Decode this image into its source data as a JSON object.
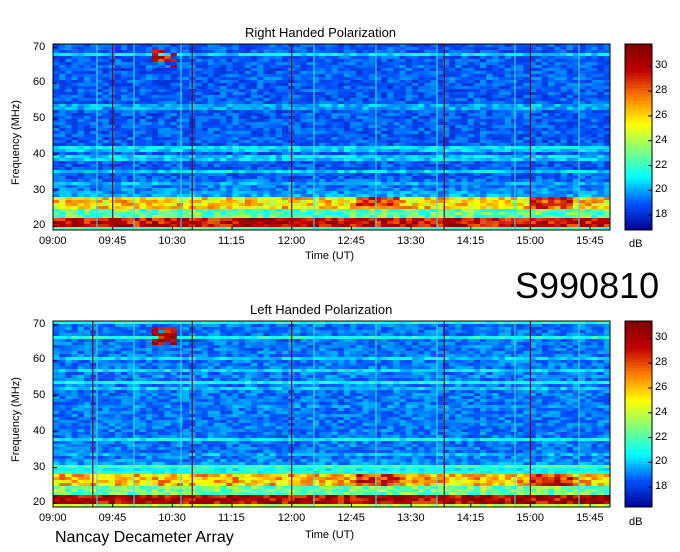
{
  "figure": {
    "dataset_id": "S990810",
    "instrument": "Nancay Decameter Array"
  },
  "panels": [
    {
      "title": "Right Handed Polarization",
      "xlabel": "Time (UT)",
      "ylabel": "Frequency (MHz)",
      "colorbar_unit": "dB"
    },
    {
      "title": "Left Handed Polarization",
      "xlabel": "Time (UT)",
      "ylabel": "Frequency (MHz)",
      "colorbar_unit": "dB"
    }
  ],
  "chart_data": [
    {
      "type": "heatmap",
      "title": "Right Handed Polarization",
      "xlabel": "Time (UT)",
      "ylabel": "Frequency (MHz)",
      "x_ticks": [
        "09:00",
        "09:45",
        "10:30",
        "11:15",
        "12:00",
        "12:45",
        "13:30",
        "14:15",
        "15:00",
        "15:45"
      ],
      "x_range_minutes_ut": [
        540,
        960
      ],
      "y_ticks": [
        20,
        30,
        40,
        50,
        60,
        70
      ],
      "ylim": [
        19,
        71
      ],
      "colorbar": {
        "unit": "dB",
        "ticks": [
          18,
          20,
          22,
          24,
          26,
          28,
          30
        ],
        "range": [
          16.8,
          31.8
        ]
      },
      "vertical_markers_ut": [
        "09:45",
        "10:45",
        "12:00",
        "13:55",
        "15:00"
      ],
      "colormap": [
        "#00008f",
        "#0050ff",
        "#00ffff",
        "#7fff7f",
        "#ffff00",
        "#ff8000",
        "#c00000",
        "#800000"
      ],
      "features": {
        "strong_band_MHz": [
          20,
          22
        ],
        "secondary_band_MHz": [
          25,
          28
        ],
        "background_dB": 19
      }
    },
    {
      "type": "heatmap",
      "title": "Left Handed Polarization",
      "xlabel": "Time (UT)",
      "ylabel": "Frequency (MHz)",
      "x_ticks": [
        "09:00",
        "09:45",
        "10:30",
        "11:15",
        "12:00",
        "12:45",
        "13:30",
        "14:15",
        "15:00",
        "15:45"
      ],
      "x_range_minutes_ut": [
        540,
        960
      ],
      "y_ticks": [
        20,
        30,
        40,
        50,
        60,
        70
      ],
      "ylim": [
        19,
        71
      ],
      "colorbar": {
        "unit": "dB",
        "ticks": [
          18,
          20,
          22,
          24,
          26,
          28,
          30
        ],
        "range": [
          16.4,
          31.4
        ]
      },
      "vertical_markers_ut": [
        "09:30",
        "10:45",
        "12:00",
        "13:55",
        "15:00"
      ],
      "colormap": [
        "#00008f",
        "#0050ff",
        "#00ffff",
        "#7fff7f",
        "#ffff00",
        "#ff8000",
        "#c00000",
        "#800000"
      ],
      "features": {
        "strong_band_MHz": [
          20,
          22
        ],
        "secondary_band_MHz": [
          25,
          28
        ],
        "background_dB": 19
      }
    }
  ]
}
